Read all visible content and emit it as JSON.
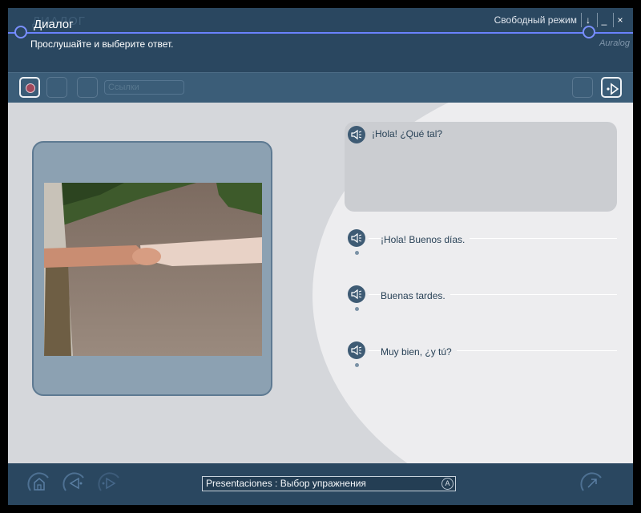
{
  "header": {
    "title": "Диалог",
    "instruction": "Прослушайте и выберите ответ.",
    "mode_label": "Свободный режим",
    "win_buttons": [
      "↓",
      "_",
      "×"
    ],
    "brand": "Auralog"
  },
  "toolbar": {
    "links_select": "Ссылки"
  },
  "dialog": {
    "prompt": "¡Hola! ¿Qué tal?",
    "options": [
      "¡Hola! Buenos días.",
      "Buenas tardes.",
      "Muy bien, ¿y tú?"
    ]
  },
  "footer": {
    "status": "Presentaciones : Выбор упражнения",
    "status_arrow": "A"
  },
  "colors": {
    "accent_line": "#6a82ff",
    "header_bg": "#2a4760",
    "content_bg": "#d5d7db"
  }
}
